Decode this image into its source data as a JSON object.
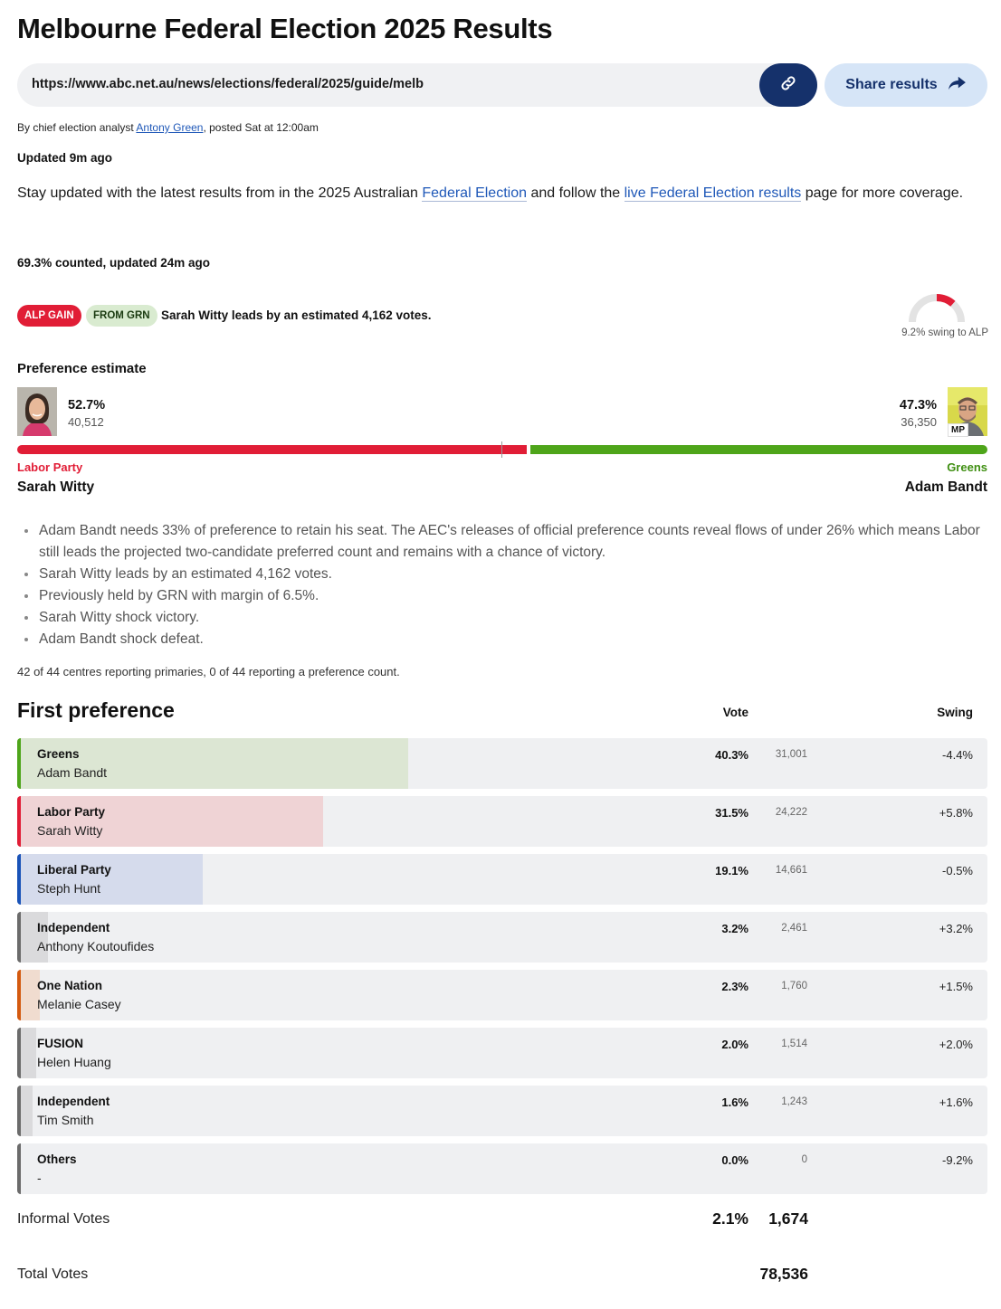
{
  "page_title": "Melbourne Federal Election 2025 Results",
  "share_bar": {
    "url": "https://www.abc.net.au/news/elections/federal/2025/guide/melb",
    "copy_icon": "link-icon",
    "share_label": "Share results",
    "share_icon": "share-arrow-icon"
  },
  "byline": {
    "prefix": "By chief election analyst ",
    "author": "Antony Green",
    "suffix": ", posted Sat at  12:00am"
  },
  "updated": "Updated 9m ago",
  "intro": {
    "text1": "Stay updated with the latest results from in the 2025 Australian ",
    "link1": "Federal Election",
    "text2": " and follow the ",
    "link2": "live Federal Election results",
    "text3": " page for more coverage."
  },
  "counted": "69.3% counted, updated 24m ago",
  "status": {
    "gain_badge": "ALP GAIN",
    "from_badge": "FROM GRN",
    "lead_text": "Sarah Witty leads by an estimated 4,162 votes.",
    "swing_caption": "9.2% swing to ALP",
    "swing_value": 9.2
  },
  "preference": {
    "heading": "Preference estimate",
    "left": {
      "pct": "52.7%",
      "votes": "40,512",
      "party": "Labor Party",
      "name": "Sarah Witty",
      "share": 52.7,
      "color": "#e11d36"
    },
    "right": {
      "pct": "47.3%",
      "votes": "36,350",
      "party": "Greens",
      "name": "Adam Bandt",
      "share": 47.3,
      "color": "#4ea51a",
      "badge": "MP"
    }
  },
  "notes": [
    "Adam Bandt needs 33% of preference to retain his seat. The AEC's releases of official preference counts reveal flows of under 26% which means Labor still leads the projected two-candidate preferred count and remains with a chance of victory.",
    "Sarah Witty leads by an estimated 4,162 votes.",
    "Previously held by GRN with margin of 6.5%.",
    "Sarah Witty shock victory.",
    "Adam Bandt shock defeat."
  ],
  "reporting": "42 of 44 centres reporting primaries, 0 of 44 reporting a preference count.",
  "first_preference": {
    "heading": "First preference",
    "col_vote": "Vote",
    "col_swing": "Swing",
    "rows": [
      {
        "party": "Greens",
        "candidate": "Adam Bandt",
        "pct": "40.3%",
        "votes": "31,001",
        "swing": "-4.4%",
        "share": 40.3,
        "edge": "#4ea51a",
        "fill": "#dce6d3"
      },
      {
        "party": "Labor Party",
        "candidate": "Sarah Witty",
        "pct": "31.5%",
        "votes": "24,222",
        "swing": "+5.8%",
        "share": 31.5,
        "edge": "#e11d36",
        "fill": "#efd3d5"
      },
      {
        "party": "Liberal Party",
        "candidate": "Steph Hunt",
        "pct": "19.1%",
        "votes": "14,661",
        "swing": "-0.5%",
        "share": 19.1,
        "edge": "#1953b8",
        "fill": "#d5dbec"
      },
      {
        "party": "Independent",
        "candidate": "Anthony Koutoufides",
        "pct": "3.2%",
        "votes": "2,461",
        "swing": "+3.2%",
        "share": 3.2,
        "edge": "#6b6b6b",
        "fill": "#dadadc"
      },
      {
        "party": "One Nation",
        "candidate": "Melanie Casey",
        "pct": "2.3%",
        "votes": "1,760",
        "swing": "+1.5%",
        "share": 2.3,
        "edge": "#d45a10",
        "fill": "#f0dccf"
      },
      {
        "party": "FUSION",
        "candidate": "Helen Huang",
        "pct": "2.0%",
        "votes": "1,514",
        "swing": "+2.0%",
        "share": 2.0,
        "edge": "#6b6b6b",
        "fill": "#dadadc"
      },
      {
        "party": "Independent",
        "candidate": "Tim Smith",
        "pct": "1.6%",
        "votes": "1,243",
        "swing": "+1.6%",
        "share": 1.6,
        "edge": "#6b6b6b",
        "fill": "#dadadc"
      },
      {
        "party": "Others",
        "candidate": "-",
        "pct": "0.0%",
        "votes": "0",
        "swing": "-9.2%",
        "share": 0.0,
        "edge": "#6b6b6b",
        "fill": "#dadadc"
      }
    ]
  },
  "informal": {
    "label": "Informal Votes",
    "pct": "2.1%",
    "votes": "1,674"
  },
  "total": {
    "label": "Total Votes",
    "votes": "78,536"
  }
}
